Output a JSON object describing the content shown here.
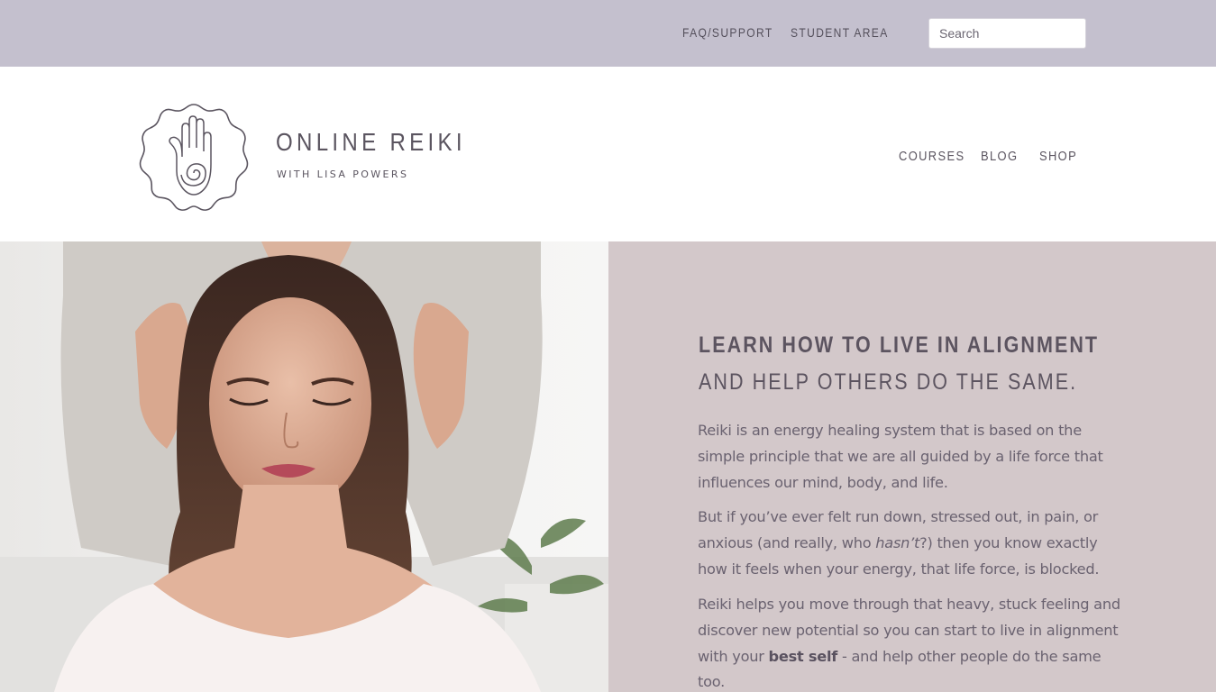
{
  "topbar": {
    "links": [
      "FAQ/SUPPORT",
      "STUDENT AREA"
    ],
    "search": {
      "placeholder": "Search",
      "value": ""
    },
    "background_color": "#c4c0ce"
  },
  "header": {
    "logo": {
      "icon": "hamsa-hand-spiral-icon"
    },
    "brand_title": "ONLINE REIKI",
    "brand_subtitle": "WITH LISA POWERS",
    "nav": [
      "COURSES",
      "BLOG",
      "SHOP"
    ]
  },
  "hero": {
    "image": {
      "icon": "reiki-session-photo"
    },
    "heading_line1": "LEARN HOW TO LIVE IN ALIGNMENT",
    "heading_line2": "AND HELP OTHERS DO THE SAME.",
    "paragraph1": "Reiki is an energy healing system that is based on the simple principle that we are all guided by a life force that influences our mind, body, and life.",
    "paragraph2": {
      "before": "But if you’ve ever felt run down, stressed out, in pain, or anxious (and really, who ",
      "emphasis": "hasn’t",
      "after": "?) then you know exactly how it feels when your energy, that life force, is blocked."
    },
    "paragraph3": {
      "before": "Reiki helps you move through that heavy, stuck feeling and discover new potential so you can start to live in alignment with your ",
      "strong": "best self",
      "after": " - and help other people do the same too."
    },
    "panel_color": "#d3c8ca"
  }
}
